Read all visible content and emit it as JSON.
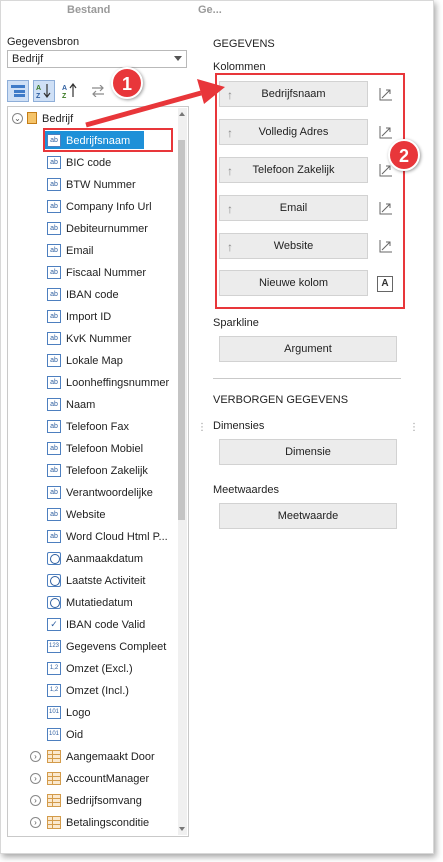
{
  "top_tabs": [
    "Bestand",
    "Ge..."
  ],
  "left": {
    "data_source_label": "Gegevensbron",
    "data_source_value": "Bedrijf",
    "root_label": "Bedrijf",
    "fields": [
      {
        "label": "Bedrijfsnaam",
        "icon": "text-field-icon",
        "type": "ab"
      },
      {
        "label": "BIC code",
        "icon": "text-field-icon",
        "type": "ab"
      },
      {
        "label": "BTW Nummer",
        "icon": "text-field-icon",
        "type": "ab"
      },
      {
        "label": "Company Info Url",
        "icon": "text-field-icon",
        "type": "ab"
      },
      {
        "label": "Debiteurnummer",
        "icon": "text-field-icon",
        "type": "ab"
      },
      {
        "label": "Email",
        "icon": "text-field-icon",
        "type": "ab"
      },
      {
        "label": "Fiscaal Nummer",
        "icon": "text-field-icon",
        "type": "ab"
      },
      {
        "label": "IBAN code",
        "icon": "text-field-icon",
        "type": "ab"
      },
      {
        "label": "Import ID",
        "icon": "text-field-icon",
        "type": "ab"
      },
      {
        "label": "KvK Nummer",
        "icon": "text-field-icon",
        "type": "ab"
      },
      {
        "label": "Lokale Map",
        "icon": "text-field-icon",
        "type": "ab"
      },
      {
        "label": "Loonheffingsnummer",
        "icon": "text-field-icon",
        "type": "ab"
      },
      {
        "label": "Naam",
        "icon": "text-field-icon",
        "type": "ab"
      },
      {
        "label": "Telefoon Fax",
        "icon": "text-field-icon",
        "type": "ab"
      },
      {
        "label": "Telefoon Mobiel",
        "icon": "text-field-icon",
        "type": "ab"
      },
      {
        "label": "Telefoon Zakelijk",
        "icon": "text-field-icon",
        "type": "ab"
      },
      {
        "label": "Verantwoordelijke",
        "icon": "text-field-icon",
        "type": "ab"
      },
      {
        "label": "Website",
        "icon": "text-field-icon",
        "type": "ab"
      },
      {
        "label": "Word Cloud Html P...",
        "icon": "text-field-icon",
        "type": "ab"
      },
      {
        "label": "Aanmaakdatum",
        "icon": "date-field-icon",
        "type": "clock"
      },
      {
        "label": "Laatste Activiteit",
        "icon": "date-field-icon",
        "type": "clock"
      },
      {
        "label": "Mutatiedatum",
        "icon": "date-field-icon",
        "type": "clock"
      },
      {
        "label": "IBAN code Valid",
        "icon": "boolean-field-icon",
        "type": "check"
      },
      {
        "label": "Gegevens Compleet",
        "icon": "integer-field-icon",
        "type": "num",
        "glyph": "123"
      },
      {
        "label": "Omzet (Excl.)",
        "icon": "decimal-field-icon",
        "type": "num",
        "glyph": "1,2"
      },
      {
        "label": "Omzet (Incl.)",
        "icon": "decimal-field-icon",
        "type": "num",
        "glyph": "1,2"
      },
      {
        "label": "Logo",
        "icon": "binary-field-icon",
        "type": "num",
        "glyph": "101"
      },
      {
        "label": "Oid",
        "icon": "binary-field-icon",
        "type": "num",
        "glyph": "101"
      }
    ],
    "relations": [
      {
        "label": "Aangemaakt Door"
      },
      {
        "label": "AccountManager"
      },
      {
        "label": "Bedrijfsomvang"
      },
      {
        "label": "Betalingsconditie"
      }
    ]
  },
  "right": {
    "gegevens_title": "GEGEVENS",
    "kolommen_label": "Kolommen",
    "columns": [
      "Bedrijfsnaam",
      "Volledig Adres",
      "Telefoon Zakelijk",
      "Email",
      "Website"
    ],
    "new_column_label": "Nieuwe kolom",
    "new_column_icon_text": "A",
    "sparkline_label": "Sparkline",
    "argument_label": "Argument",
    "hidden_title": "VERBORGEN GEGEVENS",
    "dimensions_label": "Dimensies",
    "dimension_button": "Dimensie",
    "measures_label": "Meetwaardes",
    "measure_button": "Meetwaarde"
  },
  "badges": [
    "1",
    "2"
  ],
  "colors": {
    "selection": "#1e90d8",
    "callout_red": "#e8363a",
    "button_bg": "#ececec"
  }
}
